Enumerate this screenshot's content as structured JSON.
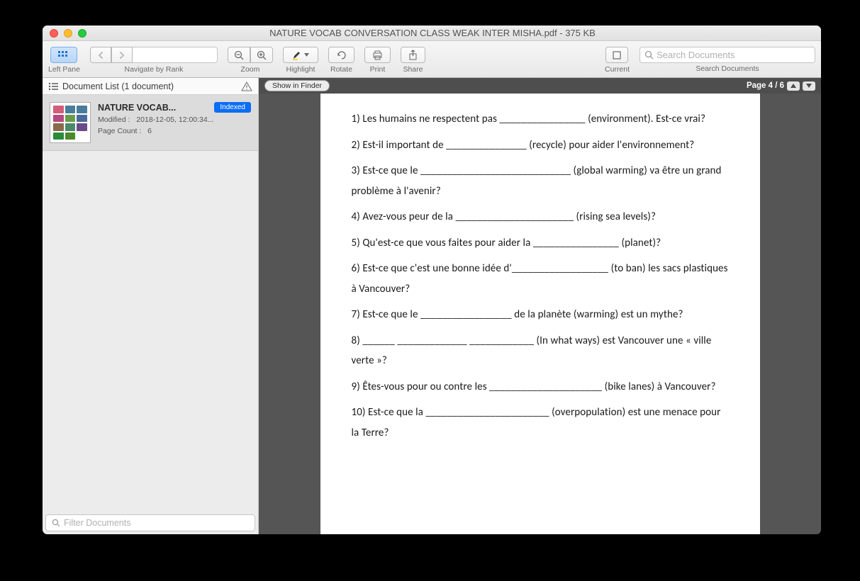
{
  "window_title": "NATURE VOCAB CONVERSATION CLASS WEAK INTER MISHA.pdf - 375 KB",
  "toolbar": {
    "left_pane": "Left Pane",
    "navigate": "Navigate by Rank",
    "zoom": "Zoom",
    "highlight": "Highlight",
    "rotate": "Rotate",
    "print": "Print",
    "share": "Share",
    "current": "Current",
    "search_docs": "Search Documents",
    "search_placeholder": "Search Documents"
  },
  "sidebar": {
    "header": "Document List (1 document)",
    "doc": {
      "name": "NATURE VOCAB...",
      "badge": "Indexed",
      "modified_label": "Modified :",
      "modified_value": "2018-12-05, 12:00:34...",
      "pagecount_label": "Page Count :",
      "pagecount_value": "6"
    },
    "filter_placeholder": "Filter Documents"
  },
  "content": {
    "show_in_finder": "Show in Finder",
    "page_indicator": "Page 4 / 6",
    "lines": [
      "1) Les humains ne respectent pas ________________ (environment). Est-ce vrai?",
      "2) Est-il important de _______________ (recycle) pour aider l'environnement?",
      "3) Est-ce que le ____________________________ (global warming) va être un grand problème à l'avenir?",
      "4) Avez-vous peur de la ______________________ (rising sea levels)?",
      "5) Qu'est-ce que vous faites pour aider la ________________ (planet)?",
      "6) Est-ce que c'est une bonne idée d'__________________ (to ban) les sacs plastiques à Vancouver?",
      "7) Est-ce que le _________________ de la planète (warming) est un mythe?",
      "8) ______ _____________ ____________ (In what ways) est Vancouver une « ville verte »?",
      "9) Êtes-vous pour ou contre les _____________________ (bike lanes) à Vancouver?",
      "10) Est-ce que la _______________________ (overpopulation) est une menace pour la Terre?"
    ]
  }
}
